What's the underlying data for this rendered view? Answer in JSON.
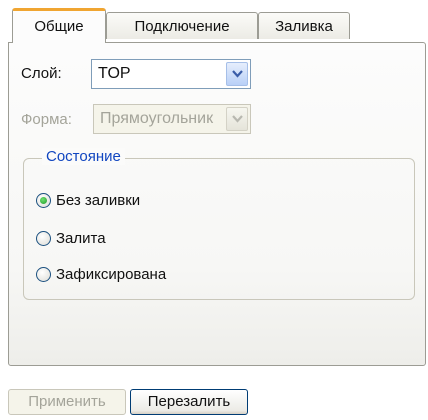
{
  "tabs": [
    {
      "label": "Общие",
      "active": true
    },
    {
      "label": "Подключение",
      "active": false
    },
    {
      "label": "Заливка",
      "active": false
    }
  ],
  "layer": {
    "label": "Слой:",
    "value": "TOP"
  },
  "shape": {
    "label": "Форма:",
    "value": "Прямоугольник",
    "disabled": true
  },
  "state_group": {
    "title": "Состояние",
    "options": [
      {
        "label": "Без заливки",
        "selected": true
      },
      {
        "label": "Залита",
        "selected": false
      },
      {
        "label": "Зафиксирована",
        "selected": false
      }
    ]
  },
  "buttons": {
    "apply": {
      "label": "Применить",
      "disabled": true
    },
    "refill": {
      "label": "Перезалить",
      "disabled": false
    }
  },
  "colors": {
    "active_tab_accent": "#f0a531",
    "group_title": "#1146c0",
    "radio_dot": "#1f9a2a"
  },
  "icons": {
    "dropdown": "chevron-down-icon"
  }
}
